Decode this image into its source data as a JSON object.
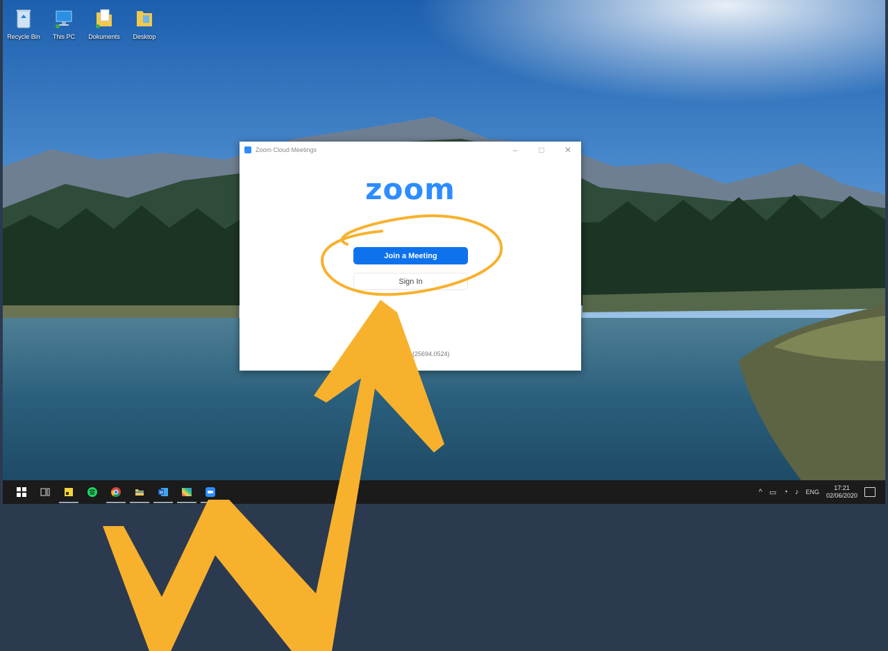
{
  "desktop": {
    "icons": [
      {
        "label": "Recycle Bin",
        "icon": "recycle-bin-icon"
      },
      {
        "label": "This PC",
        "icon": "computer-icon"
      },
      {
        "label": "Dokuments",
        "icon": "documents-folder-icon"
      },
      {
        "label": "Desktop",
        "icon": "desktop-folder-icon"
      }
    ]
  },
  "window": {
    "title": "Zoom Cloud Meetings",
    "controls": {
      "minimize": "–",
      "maximize": "□",
      "close": "✕"
    },
    "logo": "zoom",
    "join_label": "Join a Meeting",
    "signin_label": "Sign In",
    "version": "(25694.0524)"
  },
  "taskbar": {
    "apps": [
      {
        "name": "start-button",
        "icon": "windows-logo-icon",
        "running": false
      },
      {
        "name": "task-view-button",
        "icon": "task-view-icon",
        "running": false
      },
      {
        "name": "sticky-notes",
        "icon": "sticky-notes-icon",
        "running": true
      },
      {
        "name": "spotify",
        "icon": "spotify-icon",
        "running": false
      },
      {
        "name": "chrome",
        "icon": "chrome-icon",
        "running": true
      },
      {
        "name": "file-explorer",
        "icon": "folder-icon",
        "running": true
      },
      {
        "name": "word",
        "icon": "word-icon",
        "running": true
      },
      {
        "name": "photos",
        "icon": "gradient-app-icon",
        "running": true
      },
      {
        "name": "zoom",
        "icon": "zoom-app-icon",
        "running": true
      }
    ],
    "tray": {
      "language": "ENG",
      "time": "17:21",
      "date": "02/06/2020"
    }
  },
  "colors": {
    "zoom_blue": "#2d8cff",
    "join_button": "#0e72ed",
    "annotation": "#f8b12c",
    "page_background": "#2c3a4f"
  }
}
